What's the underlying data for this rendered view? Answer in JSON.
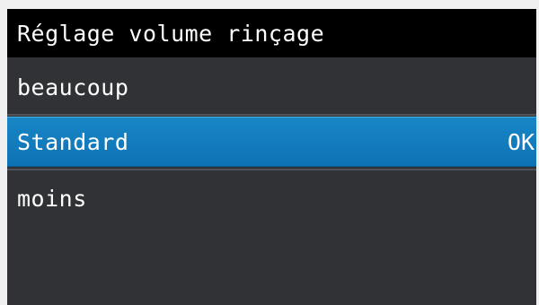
{
  "header": {
    "title": "Réglage volume rinçage"
  },
  "menu": {
    "items": [
      {
        "label": "beaucoup",
        "selected": false
      },
      {
        "label": "Standard",
        "selected": true,
        "tag": "OK"
      },
      {
        "label": "moins",
        "selected": false
      }
    ]
  },
  "colors": {
    "background": "#303235",
    "title_bar": "#000000",
    "selection": "#1580c0",
    "text": "#ffffff"
  }
}
